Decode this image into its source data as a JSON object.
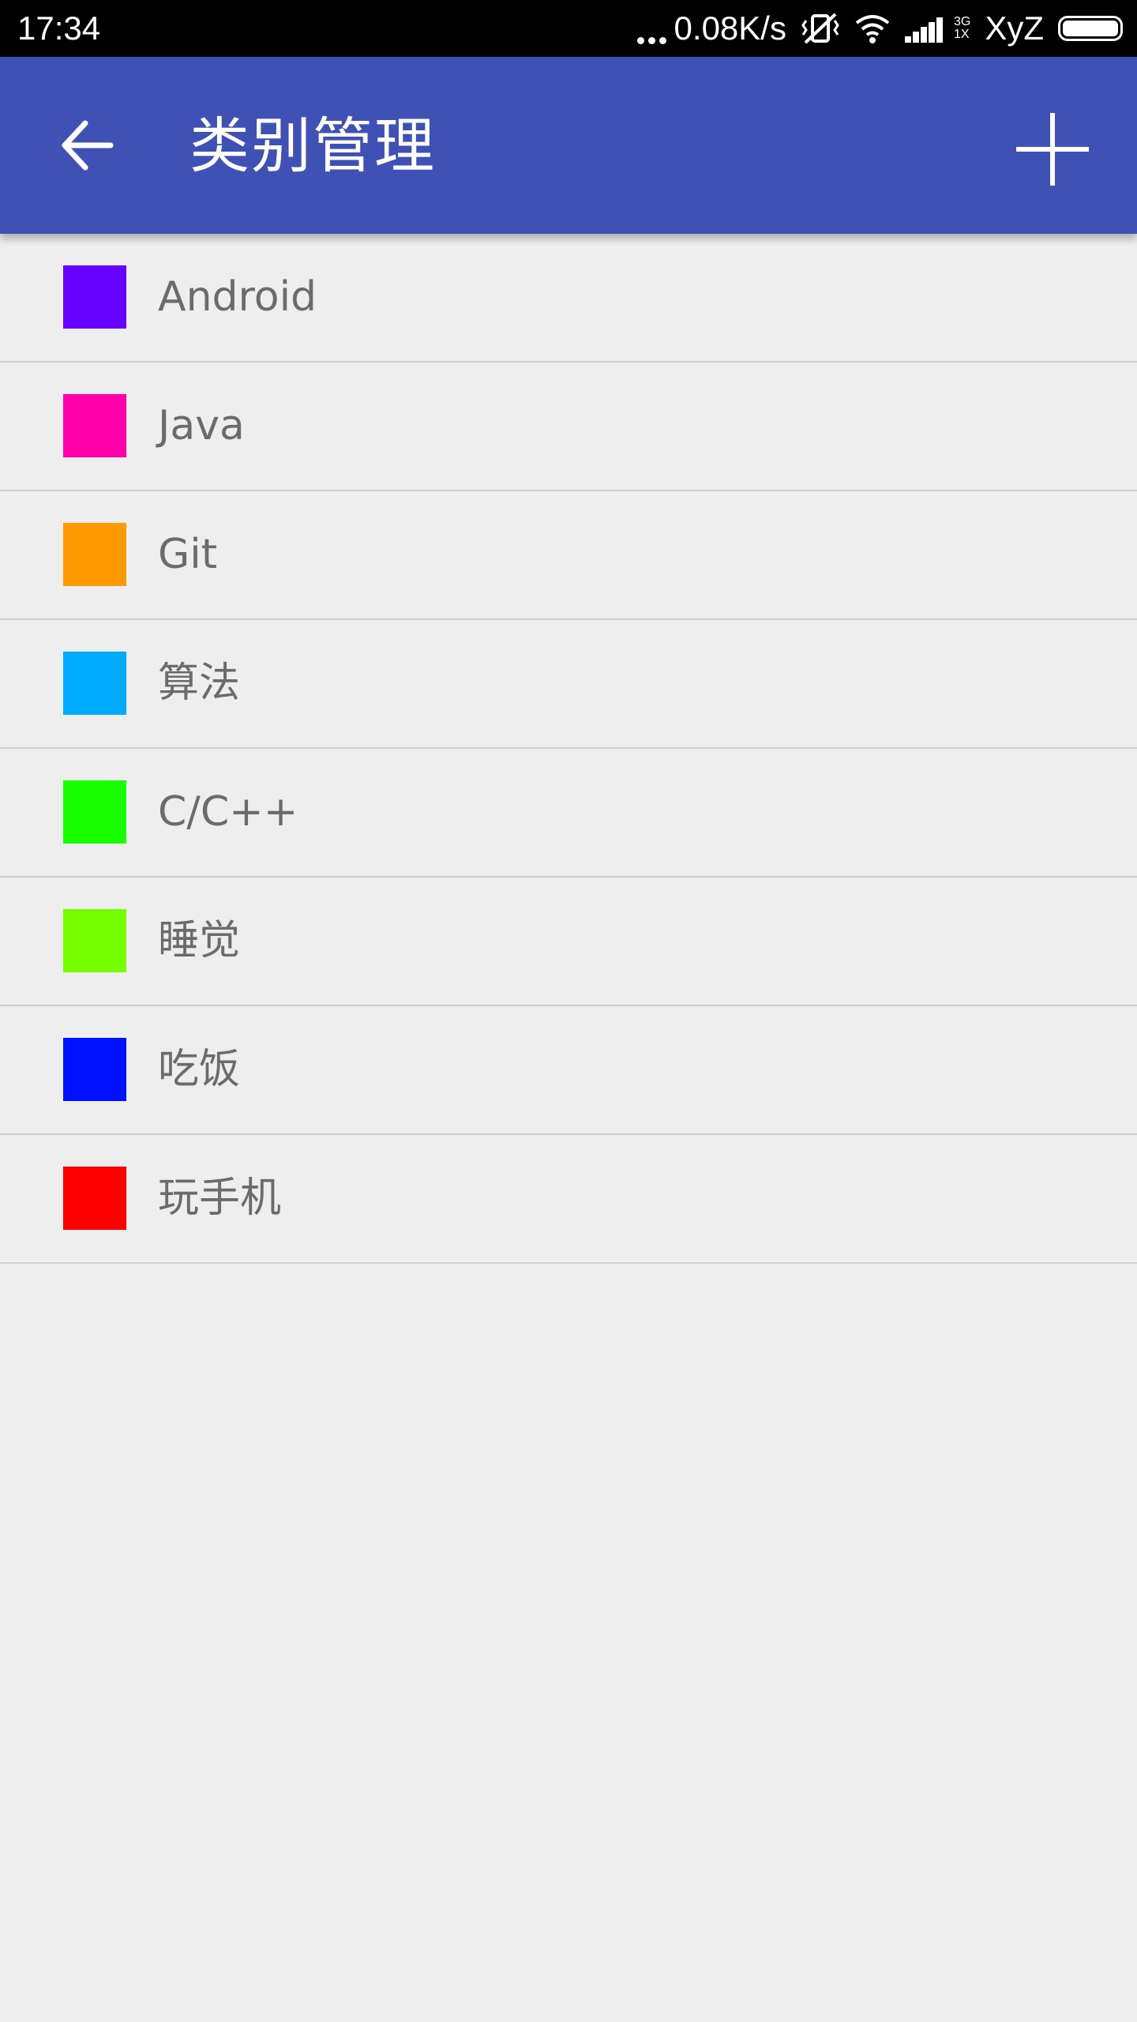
{
  "status_bar": {
    "time": "17:34",
    "net_speed": "0.08K/s",
    "net_type_top": "3G",
    "net_type_bottom": "1X",
    "carrier": "XyZ",
    "icons": [
      "more-dots-icon",
      "vibrate-icon",
      "wifi-icon",
      "signal-icon",
      "battery-icon"
    ]
  },
  "app_bar": {
    "title": "类别管理",
    "back_icon": "arrow-left-icon",
    "add_icon": "plus-icon",
    "background_color": "#3f51b5"
  },
  "categories": [
    {
      "label": "Android",
      "color": "#6600ff"
    },
    {
      "label": "Java",
      "color": "#ff00aa"
    },
    {
      "label": "Git",
      "color": "#ff9900"
    },
    {
      "label": "算法",
      "color": "#00aaff"
    },
    {
      "label": "C/C++",
      "color": "#1aff00"
    },
    {
      "label": "睡觉",
      "color": "#77ff00"
    },
    {
      "label": "吃饭",
      "color": "#0011ff"
    },
    {
      "label": "玩手机",
      "color": "#ff0000"
    }
  ]
}
